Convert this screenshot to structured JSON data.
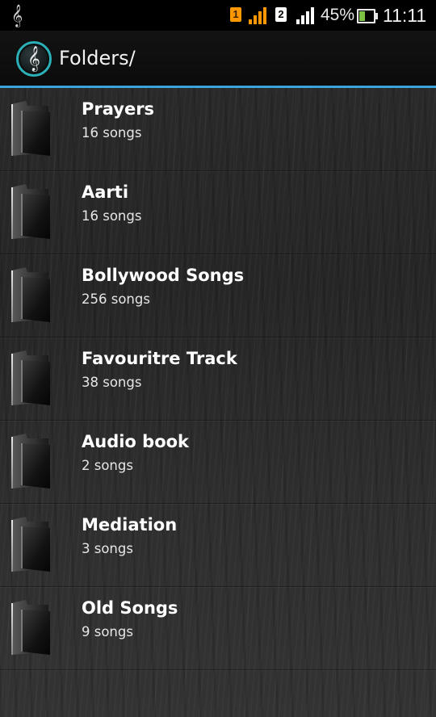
{
  "status_bar": {
    "app_icon": "music-note-icon",
    "sim1_label": "1",
    "sim2_label": "2",
    "battery_text": "45%",
    "battery_level": 0.45,
    "time": "11:11"
  },
  "action_bar": {
    "title": "Folders/",
    "icon": "treble-clef-icon",
    "accent_color": "#3aa3d8"
  },
  "folders": [
    {
      "name": "Prayers",
      "count": "16 songs"
    },
    {
      "name": "Aarti",
      "count": "16 songs"
    },
    {
      "name": "Bollywood Songs",
      "count": "256 songs"
    },
    {
      "name": "Favouritre Track",
      "count": "38 songs"
    },
    {
      "name": "Audio book",
      "count": "2 songs"
    },
    {
      "name": "Mediation",
      "count": "3 songs"
    },
    {
      "name": "Old Songs",
      "count": "9 songs"
    }
  ]
}
